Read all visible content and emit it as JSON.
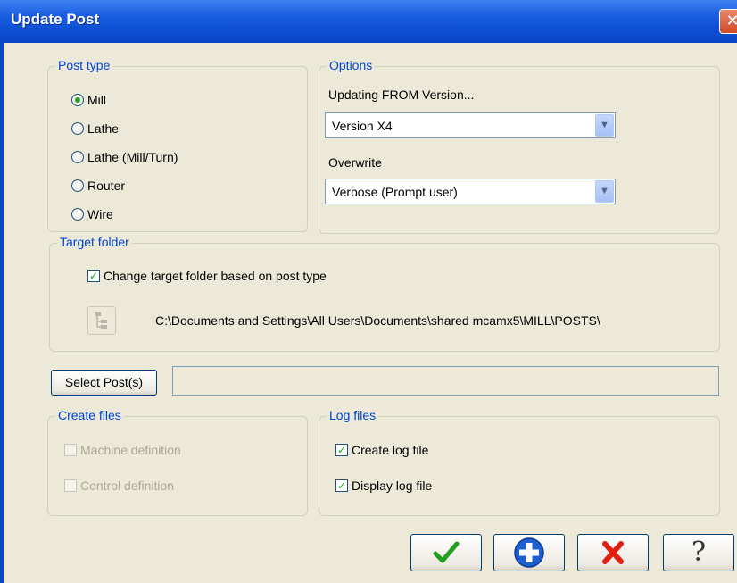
{
  "window": {
    "title": "Update Post",
    "close_glyph": "✕"
  },
  "post_type": {
    "legend": "Post type",
    "options": [
      {
        "label": "Mill",
        "selected": true
      },
      {
        "label": "Lathe",
        "selected": false
      },
      {
        "label": "Lathe (Mill/Turn)",
        "selected": false
      },
      {
        "label": "Router",
        "selected": false
      },
      {
        "label": "Wire",
        "selected": false
      }
    ]
  },
  "options": {
    "legend": "Options",
    "updating_from_label": "Updating FROM Version...",
    "updating_from_value": "Version X4",
    "overwrite_label": "Overwrite",
    "overwrite_value": "Verbose (Prompt user)"
  },
  "target_folder": {
    "legend": "Target folder",
    "change_label": "Change target folder based on post type",
    "change_checked": true,
    "path": "C:\\Documents and Settings\\All Users\\Documents\\shared mcamx5\\MILL\\POSTS\\"
  },
  "select_posts": {
    "button_label": "Select Post(s)",
    "field_value": ""
  },
  "create_files": {
    "legend": "Create files",
    "machine_definition": "Machine definition",
    "control_definition": "Control definition"
  },
  "log_files": {
    "legend": "Log files",
    "create_log": "Create log file",
    "display_log": "Display log file"
  },
  "buttons": {
    "ok_icon": "check-icon",
    "add_icon": "plus-icon",
    "cancel_icon": "x-icon",
    "help_glyph": "?"
  },
  "colors": {
    "title_bar": "#0a46c4",
    "legend_text": "#0046d5",
    "check_green": "#21a121",
    "cancel_red": "#e02010",
    "add_blue": "#1f5fd0"
  }
}
